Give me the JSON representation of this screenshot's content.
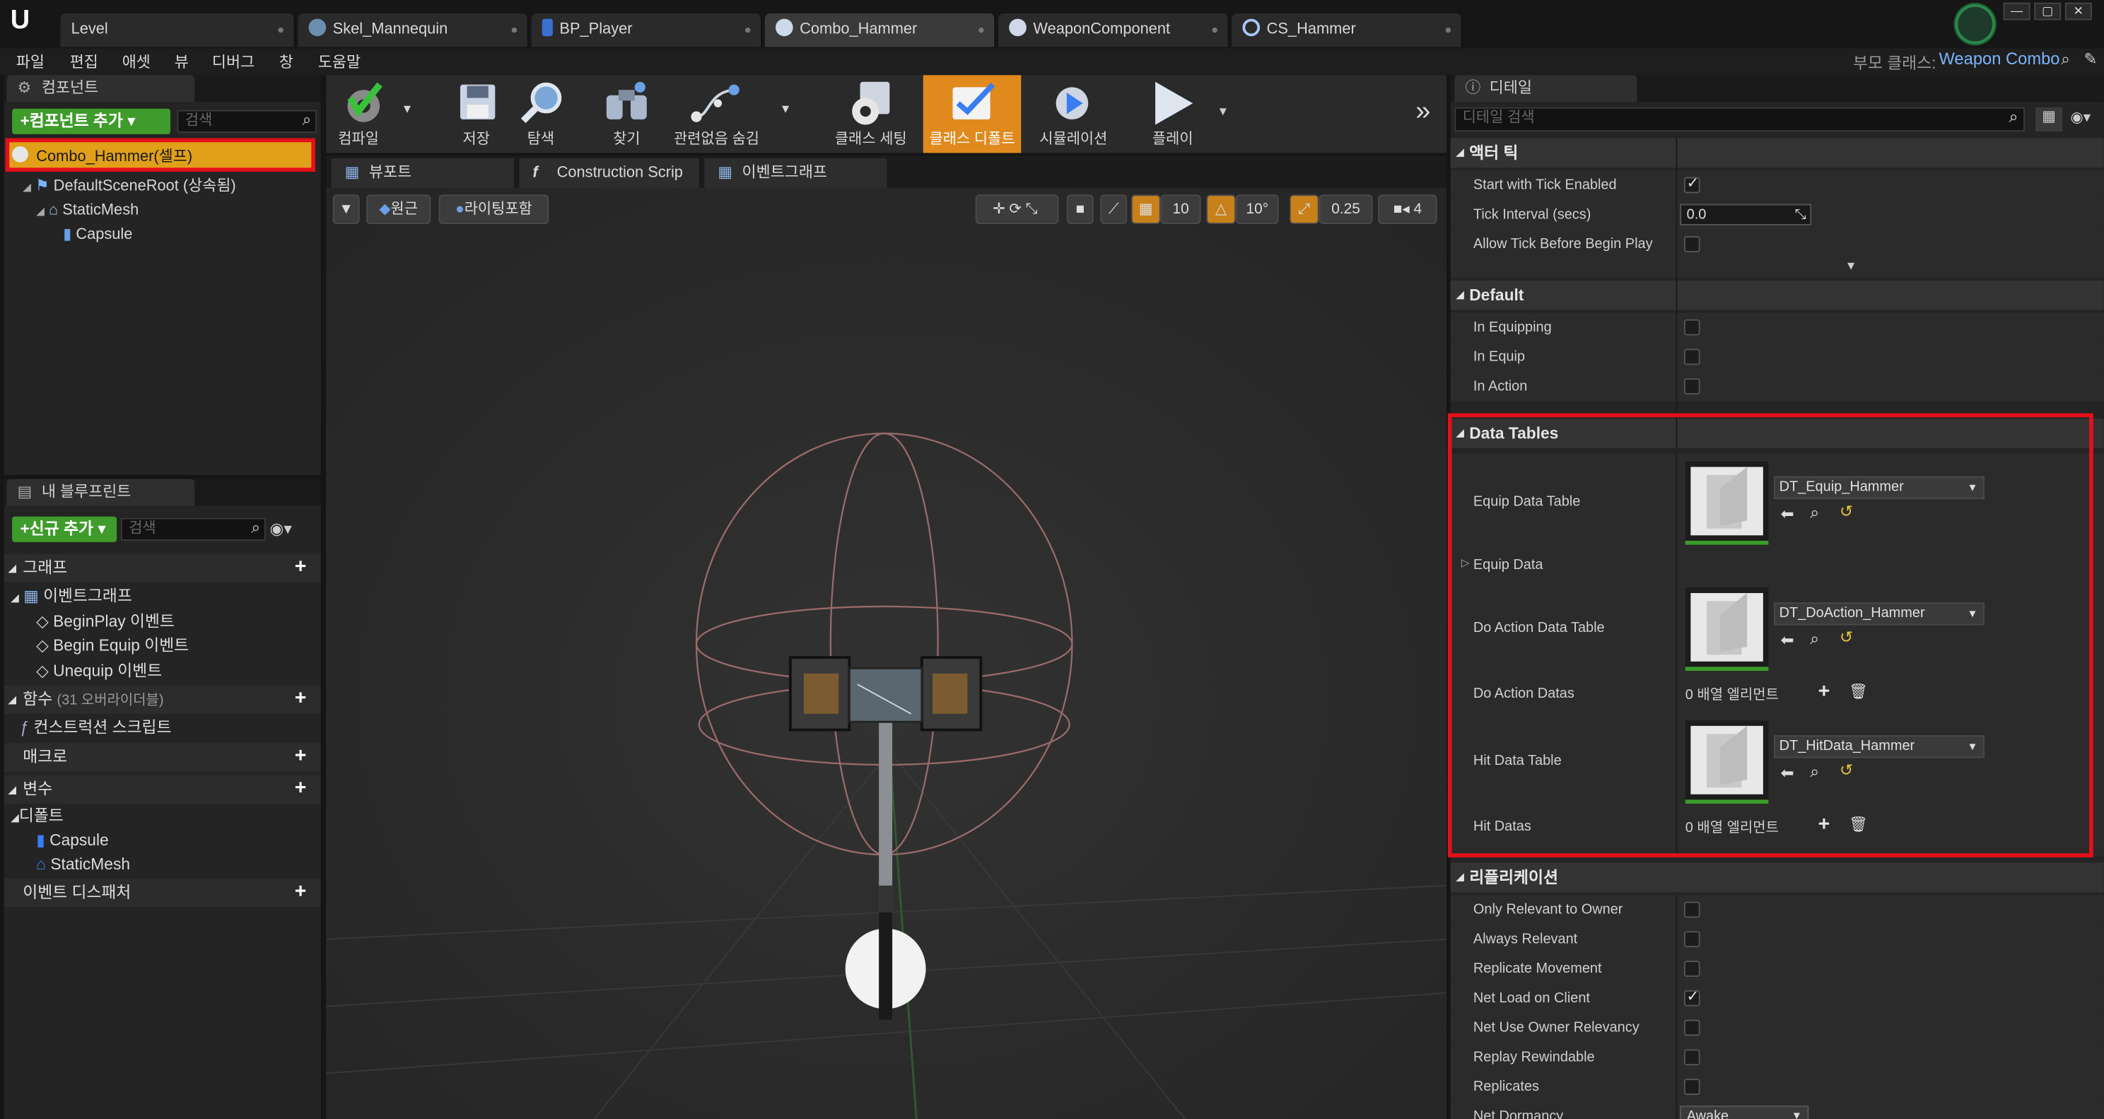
{
  "tabs": [
    {
      "label": "Level",
      "icon": "level-icon"
    },
    {
      "label": "Skel_Mannequin",
      "icon": "skeleton-icon"
    },
    {
      "label": "BP_Player",
      "icon": "blueprint-icon"
    },
    {
      "label": "Combo_Hammer",
      "icon": "blueprint-icon"
    },
    {
      "label": "WeaponComponent",
      "icon": "blueprint-icon"
    },
    {
      "label": "CS_Hammer",
      "icon": "blueprint-icon"
    }
  ],
  "menu": [
    "파일",
    "편집",
    "애셋",
    "뷰",
    "디버그",
    "창",
    "도움말"
  ],
  "parent_class": {
    "label": "부모 클래스:",
    "value": "Weapon Combo"
  },
  "components": {
    "tab": "컴포넌트",
    "add_button": "+컴포넌트 추가",
    "search_placeholder": "검색",
    "self_item": "Combo_Hammer(셀프)",
    "tree": [
      "DefaultSceneRoot (상속됨)",
      "StaticMesh",
      "Capsule"
    ]
  },
  "my_blueprint": {
    "tab": "내 블루프린트",
    "add_button": "+신규 추가",
    "search_placeholder": "검색",
    "graph_section": "그래프",
    "event_graph": "이벤트그래프",
    "events": [
      "BeginPlay 이벤트",
      "Begin Equip 이벤트",
      "Unequip 이벤트"
    ],
    "functions_section": "함수",
    "functions_count": "(31 오버라이더블)",
    "construction_script": "컨스트럭션 스크립트",
    "macros_section": "매크로",
    "variables_section": "변수",
    "defaults_section": "디폴트",
    "default_vars": [
      "Capsule",
      "StaticMesh"
    ],
    "dispatchers_section": "이벤트 디스패처"
  },
  "toolbar": {
    "compile": "컴파일",
    "save": "저장",
    "browse": "탐색",
    "find": "찾기",
    "hide_unrelated": "관련없음 숨김",
    "class_settings": "클래스 세팅",
    "class_defaults": "클래스 디폴트",
    "simulation": "시뮬레이션",
    "play": "플레이"
  },
  "viewport": {
    "tabs": [
      "뷰포트",
      "Construction Scrip",
      "이벤트그래프"
    ],
    "perspective": "원근",
    "lit": "라이팅포함",
    "grid_snap": "10",
    "rotation_snap": "10°",
    "scale_snap": "0.25",
    "camera_speed": "4"
  },
  "details": {
    "tab": "디테일",
    "search_placeholder": "디테일 검색",
    "actor_tick": {
      "title": "액터 틱",
      "start_with_tick": "Start with Tick Enabled",
      "tick_interval": "Tick Interval (secs)",
      "tick_interval_value": "0.0",
      "allow_tick": "Allow Tick Before Begin Play"
    },
    "default": {
      "title": "Default",
      "items": [
        "In Equipping",
        "In Equip",
        "In Action"
      ]
    },
    "data_tables": {
      "title": "Data Tables",
      "equip_table_label": "Equip Data Table",
      "equip_table_value": "DT_Equip_Hammer",
      "equip_data": "Equip Data",
      "do_action_table_label": "Do Action Data Table",
      "do_action_table_value": "DT_DoAction_Hammer",
      "do_action_datas": "Do Action Datas",
      "do_action_datas_value": "0 배열 엘리먼트",
      "hit_table_label": "Hit Data Table",
      "hit_table_value": "DT_HitData_Hammer",
      "hit_datas": "Hit Datas",
      "hit_datas_value": "0 배열 엘리먼트"
    },
    "replication": {
      "title": "리플리케이션",
      "items": [
        "Only Relevant to Owner",
        "Always Relevant",
        "Replicate Movement",
        "Net Load on Client",
        "Net Use Owner Relevancy",
        "Replay Rewindable",
        "Replicates"
      ],
      "net_dormancy": "Net Dormancy",
      "net_dormancy_value": "Awake"
    }
  }
}
